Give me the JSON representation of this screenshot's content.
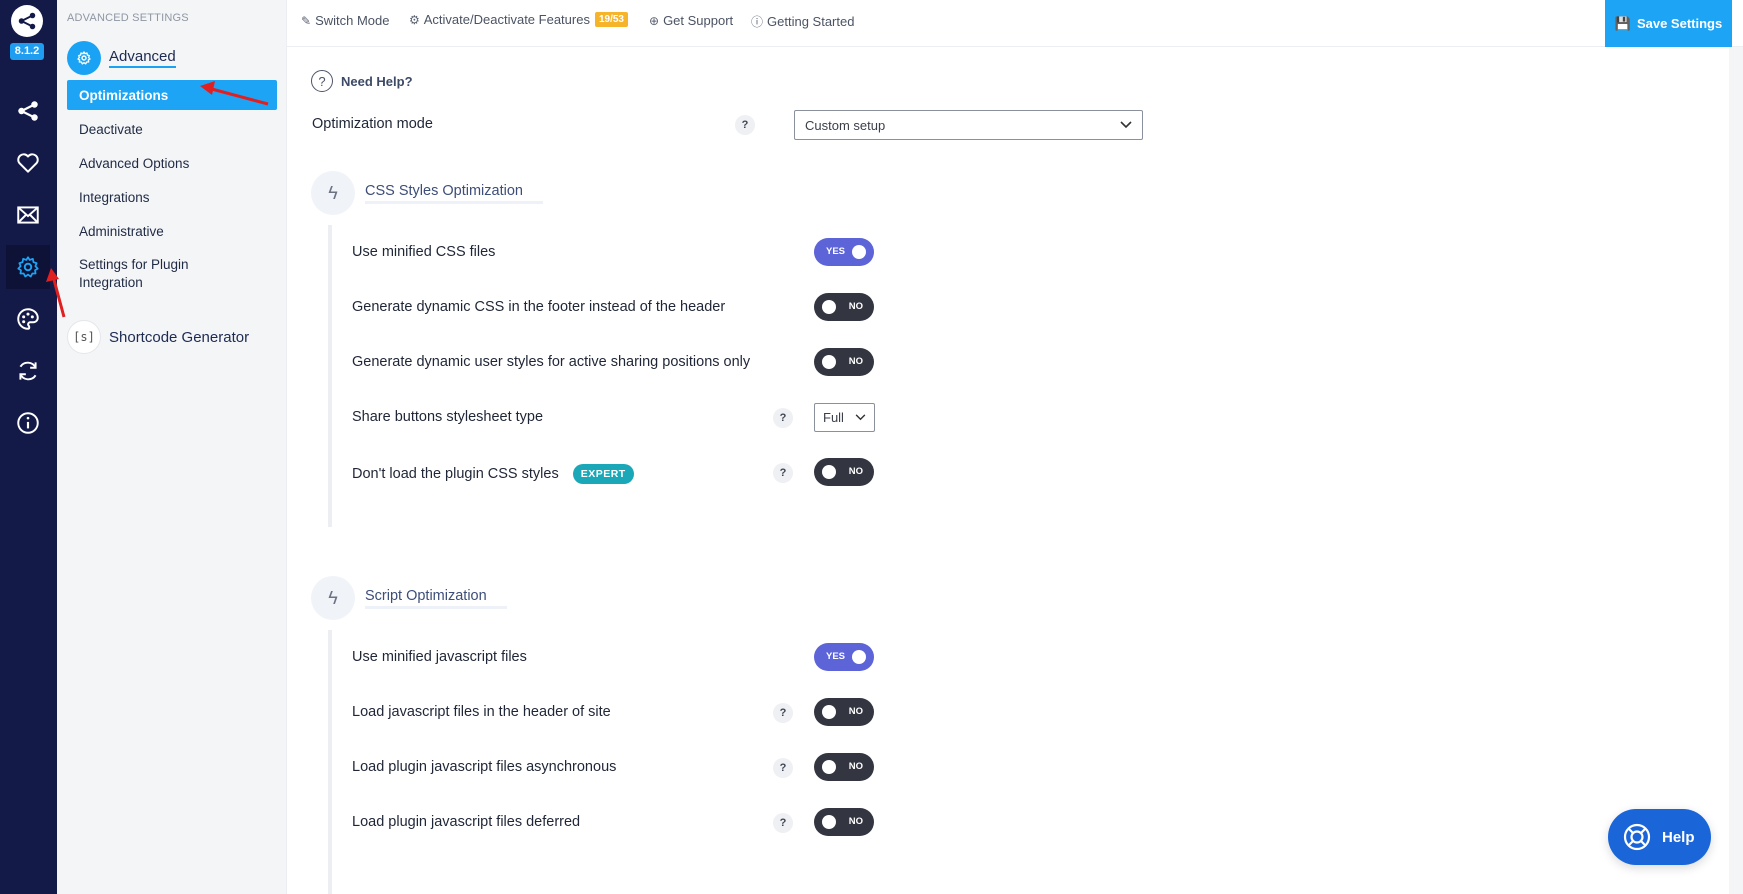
{
  "rail": {
    "version": "8.1.2",
    "items": [
      {
        "icon": "share-icon"
      },
      {
        "icon": "heart-icon"
      },
      {
        "icon": "mail-icon"
      },
      {
        "icon": "gear-icon",
        "active": true
      },
      {
        "icon": "palette-icon"
      },
      {
        "icon": "sync-icon"
      },
      {
        "icon": "info-icon"
      }
    ]
  },
  "sidebar": {
    "caption": "ADVANCED SETTINGS",
    "section_label": "Advanced",
    "items": [
      {
        "label": "Optimizations",
        "active": true
      },
      {
        "label": "Deactivate"
      },
      {
        "label": "Advanced Options"
      },
      {
        "label": "Integrations"
      },
      {
        "label": "Administrative"
      },
      {
        "label": "Settings for Plugin Integration"
      }
    ],
    "shortcode_icon": "[s]",
    "shortcode_label": "Shortcode Generator"
  },
  "topbar": {
    "switch_mode": "Switch Mode",
    "features": "Activate/Deactivate Features",
    "features_badge": "19/53",
    "support": "Get Support",
    "getting_started": "Getting Started",
    "save": "Save Settings"
  },
  "main": {
    "need_help": "Need Help?",
    "optimization_mode_label": "Optimization mode",
    "optimization_mode_value": "Custom setup",
    "qmark": "?",
    "css_section": {
      "title": "CSS Styles Optimization",
      "rows": [
        {
          "label": "Use minified CSS files",
          "type": "toggle",
          "value": "YES"
        },
        {
          "label": "Generate dynamic CSS in the footer instead of the header",
          "type": "toggle",
          "value": "NO"
        },
        {
          "label": "Generate dynamic user styles for active sharing positions only",
          "type": "toggle",
          "value": "NO"
        },
        {
          "label": "Share buttons stylesheet type",
          "type": "select",
          "value": "Full",
          "help": true
        },
        {
          "label": "Don't load the plugin CSS styles",
          "type": "toggle",
          "value": "NO",
          "help": true,
          "badge": "EXPERT"
        }
      ]
    },
    "script_section": {
      "title": "Script Optimization",
      "rows": [
        {
          "label": "Use minified javascript files",
          "type": "toggle",
          "value": "YES"
        },
        {
          "label": "Load javascript files in the header of site",
          "type": "toggle",
          "value": "NO",
          "help": true
        },
        {
          "label": "Load plugin javascript files asynchronous",
          "type": "toggle",
          "value": "NO",
          "help": true
        },
        {
          "label": "Load plugin javascript files deferred",
          "type": "toggle",
          "value": "NO",
          "help": true
        }
      ]
    }
  },
  "help_button": "Help",
  "colors": {
    "rail": "#141a48",
    "accent": "#1ea4f5",
    "toggle_on": "#5d64d8",
    "toggle_off": "#333640",
    "badge": "#f6b42a",
    "expert": "#1aa8b8",
    "help_button": "#1a66d9",
    "annotation": "#e02020"
  }
}
